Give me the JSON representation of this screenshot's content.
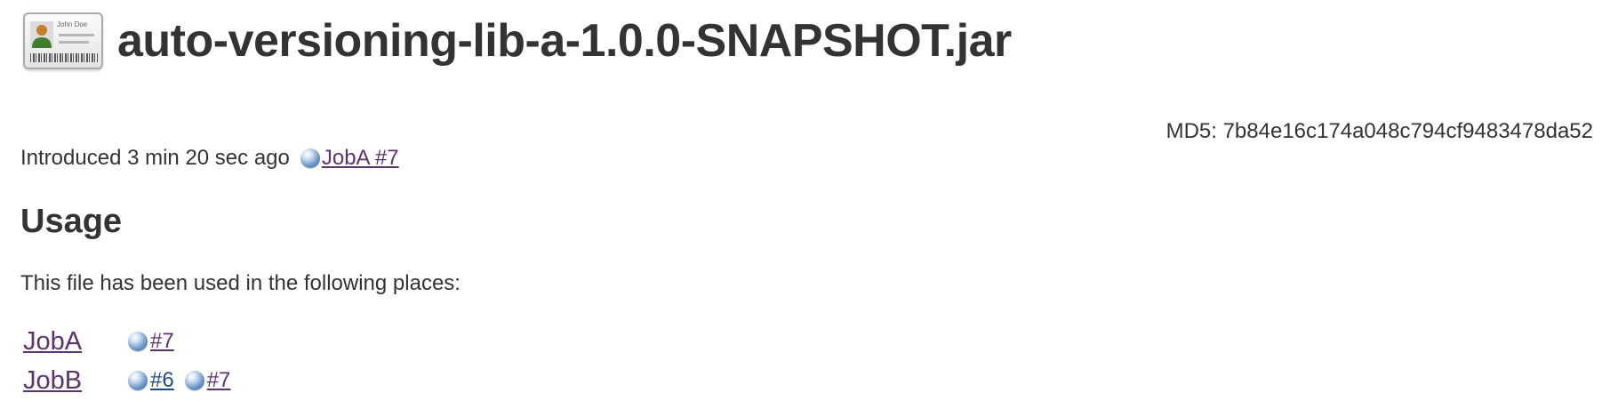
{
  "header": {
    "icon": "id-card-icon",
    "icon_text": "John Doe",
    "title": "auto-versioning-lib-a-1.0.0-SNAPSHOT.jar"
  },
  "md5_text": "MD5: 7b84e16c174a048c794cf9483478da52",
  "introduced": {
    "text": "Introduced 3 min 20 sec ago",
    "link_label": "JobA #7",
    "status_icon": "blue-ball-icon"
  },
  "usage": {
    "heading": "Usage",
    "description": "This file has been used in the following places:",
    "rows": [
      {
        "job": "JobA",
        "builds": [
          {
            "label": "#7",
            "status_icon": "blue-ball-icon"
          }
        ]
      },
      {
        "job": "JobB",
        "builds": [
          {
            "label": "#6",
            "status_icon": "blue-ball-icon"
          },
          {
            "label": "#7",
            "status_icon": "blue-ball-icon"
          }
        ]
      }
    ]
  },
  "colors": {
    "visited_link": "#5d3272",
    "link": "#204a87",
    "text": "#333333",
    "status_blue": "#2b5f9e"
  }
}
